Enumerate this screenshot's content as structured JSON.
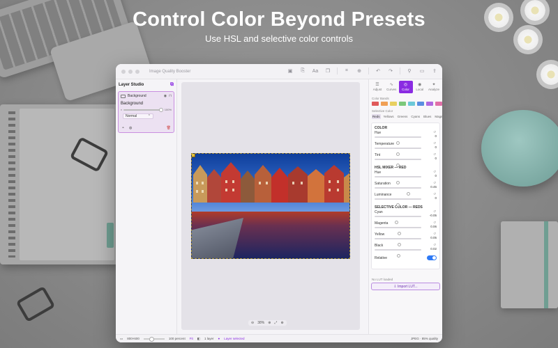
{
  "hero": {
    "title": "Control Color Beyond Presets",
    "subtitle": "Use HSL and selective color controls"
  },
  "window": {
    "title": "Image Quality Booster"
  },
  "layers": {
    "panel_title": "Layer Studio",
    "layer_title": "Background",
    "layer_name": "Background",
    "opacity": "100%",
    "blend_mode": "Normal"
  },
  "canvas": {
    "zoom": "38%"
  },
  "inspector": {
    "tabs": [
      {
        "label": "Adjust",
        "glyph": "☰"
      },
      {
        "label": "Curves",
        "glyph": "∿"
      },
      {
        "label": "Color",
        "glyph": "◎"
      },
      {
        "label": "Local",
        "glyph": "◉"
      },
      {
        "label": "Analyze",
        "glyph": "✦"
      }
    ],
    "active_tab": "Color",
    "color_bands_label": "Color Bands",
    "band_colors": [
      "#e05a5a",
      "#f0a055",
      "#e8d060",
      "#7cc87a",
      "#6cc8d8",
      "#5a8ee0",
      "#b06ae0",
      "#e070a8"
    ],
    "selective_label": "Selective Color",
    "selective_tabs": [
      "Reds",
      "Yellows",
      "Greens",
      "Cyans",
      "Blues",
      "Magen"
    ],
    "color_header": "COLOR",
    "color_rows": [
      {
        "label": "Hue",
        "value": "0",
        "pos": 0.5
      },
      {
        "label": "Temperature",
        "value": "0",
        "pos": 0.5
      },
      {
        "label": "Tint",
        "value": "0",
        "pos": 0.5
      }
    ],
    "hsl_header": "HSL MIXER — RED",
    "hsl_rows": [
      {
        "label": "Hue",
        "value": "0",
        "pos": 0.5
      },
      {
        "label": "Saturation",
        "value": "0.45",
        "pos": 0.72
      },
      {
        "label": "Luminance",
        "value": "0",
        "pos": 0.5
      }
    ],
    "sel_header": "SELECTIVE COLOR — REDS",
    "sel_rows": [
      {
        "label": "Cyan",
        "value": "-0.05",
        "pos": 0.47
      },
      {
        "label": "Magenta",
        "value": "0.06",
        "pos": 0.53
      },
      {
        "label": "Yellow",
        "value": "0.05",
        "pos": 0.53
      },
      {
        "label": "Black",
        "value": "0.02",
        "pos": 0.51
      }
    ],
    "relative_label": "Relative",
    "relative_on": true,
    "lut_status": "No LUT loaded",
    "import_label": "Import LUT..."
  },
  "status": {
    "size": "800×600",
    "percent": "100 percent",
    "fit": "Fit",
    "layers": "1 layer",
    "selected": "Layer selected",
    "format": "JPEG · 85% quality"
  }
}
